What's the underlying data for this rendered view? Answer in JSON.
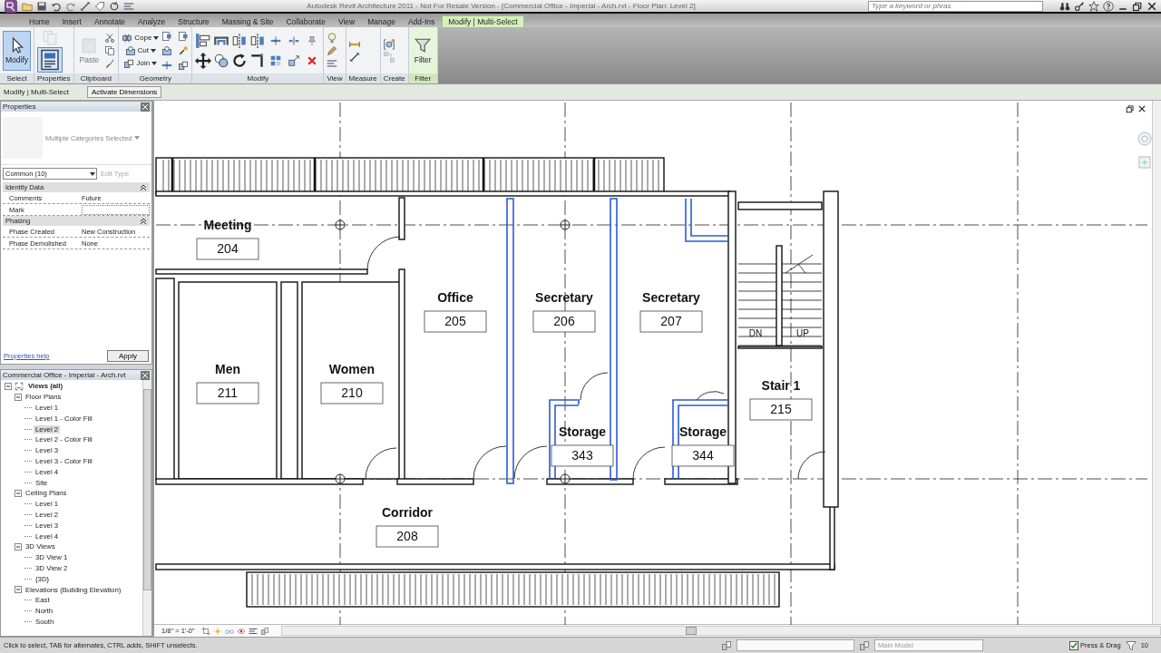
{
  "title_bar": {
    "title": "Autodesk Revit Architecture 2011 - Not For Resale Version - [Commercial Office - Imperial - Arch.rvt - Floor Plan: Level 2]",
    "search": {
      "placeholder": "Type a keyword or phras"
    }
  },
  "ribbon": {
    "tabs": [
      {
        "label": "Home",
        "selected": false
      },
      {
        "label": "Insert",
        "selected": false
      },
      {
        "label": "Annotate",
        "selected": false
      },
      {
        "label": "Analyze",
        "selected": false
      },
      {
        "label": "Structure",
        "selected": false
      },
      {
        "label": "Massing & Site",
        "selected": false
      },
      {
        "label": "Collaborate",
        "selected": false
      },
      {
        "label": "View",
        "selected": false
      },
      {
        "label": "Manage",
        "selected": false
      },
      {
        "label": "Add-Ins",
        "selected": false
      },
      {
        "label": "Modify | Multi-Select",
        "selected": true
      }
    ],
    "panels": [
      {
        "kind": "select",
        "label": "Select",
        "contextual": false,
        "buttons": [
          {
            "label": "Modify",
            "selected": true
          }
        ]
      },
      {
        "kind": "properties",
        "label": "Properties",
        "contextual": false
      },
      {
        "kind": "clipboard",
        "label": "Clipboard",
        "contextual": false,
        "buttons": [
          {
            "label": "Paste",
            "disabled": true
          }
        ]
      },
      {
        "kind": "geometry",
        "label": "Geometry",
        "contextual": false,
        "buttons": [
          {
            "label": "Cope"
          },
          {
            "label": "Cut"
          },
          {
            "label": "Join"
          }
        ]
      },
      {
        "kind": "modify",
        "label": "Modify",
        "contextual": false
      },
      {
        "kind": "view",
        "label": "View",
        "contextual": false
      },
      {
        "kind": "measure",
        "label": "Measure",
        "contextual": false
      },
      {
        "kind": "create",
        "label": "Create",
        "contextual": false
      },
      {
        "kind": "filter",
        "label": "Filter",
        "contextual": true,
        "buttons": [
          {
            "label": "Filter"
          }
        ]
      }
    ]
  },
  "options_bar": {
    "mode": "Modify | Multi-Select",
    "buttons": [
      "Activate Dimensions"
    ]
  },
  "properties": {
    "title": "Properties",
    "type_name": "Multiple Categories Selected",
    "filter": "Common (10)",
    "edit_type": {
      "label": "Edit Type",
      "disabled": true
    },
    "groups": [
      {
        "label": "Identity Data",
        "expanded": true,
        "params": [
          {
            "name": "Comments",
            "value": "Future"
          },
          {
            "name": "Mark"
          }
        ]
      },
      {
        "label": "Phasing",
        "expanded": true,
        "params": [
          {
            "name": "Phase Created",
            "value": "New Construction"
          },
          {
            "name": "Phase Demolished",
            "value": "None"
          }
        ]
      }
    ],
    "help_link": "Properties help",
    "apply": "Apply"
  },
  "browser": {
    "title": "Commercial Office - Imperial - Arch.rvt",
    "tree": [
      {
        "label": "Views (all)",
        "selected": false,
        "expanded": true,
        "children": [
          {
            "label": "Floor Plans",
            "selected": false,
            "expanded": true,
            "children": [
              {
                "label": "Level 1",
                "selected": false
              },
              {
                "label": "Level 1 - Color Fill",
                "selected": false
              },
              {
                "label": "Level 2",
                "selected": true
              },
              {
                "label": "Level 2 - Color Fill",
                "selected": false
              },
              {
                "label": "Level 3",
                "selected": false
              },
              {
                "label": "Level 3 - Color Fill",
                "selected": false
              },
              {
                "label": "Level 4",
                "selected": false
              },
              {
                "label": "Site",
                "selected": false
              }
            ]
          },
          {
            "label": "Ceiling Plans",
            "selected": false,
            "expanded": true,
            "children": [
              {
                "label": "Level 1",
                "selected": false
              },
              {
                "label": "Level 2",
                "selected": false
              },
              {
                "label": "Level 3",
                "selected": false
              },
              {
                "label": "Level 4",
                "selected": false
              }
            ]
          },
          {
            "label": "3D Views",
            "selected": false,
            "expanded": true,
            "children": [
              {
                "label": "3D View 1",
                "selected": false
              },
              {
                "label": "3D View 2",
                "selected": false
              },
              {
                "label": "{3D}",
                "selected": false
              }
            ]
          },
          {
            "label": "Elevations (Building Elevation)",
            "selected": false,
            "expanded": true,
            "children": [
              {
                "label": "East",
                "selected": false
              },
              {
                "label": "North",
                "selected": false
              },
              {
                "label": "South",
                "selected": false
              }
            ]
          }
        ]
      }
    ]
  },
  "canvas": {
    "rooms": [
      {
        "name": "Meeting",
        "number": "204"
      },
      {
        "name": "Office",
        "number": "205"
      },
      {
        "name": "Secretary",
        "number": "206"
      },
      {
        "name": "Secretary",
        "number": "207"
      },
      {
        "name": "Men",
        "number": "211"
      },
      {
        "name": "Women",
        "number": "210"
      },
      {
        "name": "Storage",
        "number": "343"
      },
      {
        "name": "Storage",
        "number": "344"
      },
      {
        "name": "Stair 1",
        "number": "215"
      },
      {
        "name": "Corridor",
        "number": "208"
      }
    ],
    "stair_labels": [
      "DN",
      "UP"
    ]
  },
  "view_bar": {
    "scale": "1/8\" = 1'-0\""
  },
  "status_bar": {
    "message": "Click to select, TAB for alternates, CTRL adds, SHIFT unselects.",
    "model": "Main Model",
    "press_drag": {
      "label": "Press & Drag",
      "checked": true
    },
    "selection_count": "10"
  }
}
